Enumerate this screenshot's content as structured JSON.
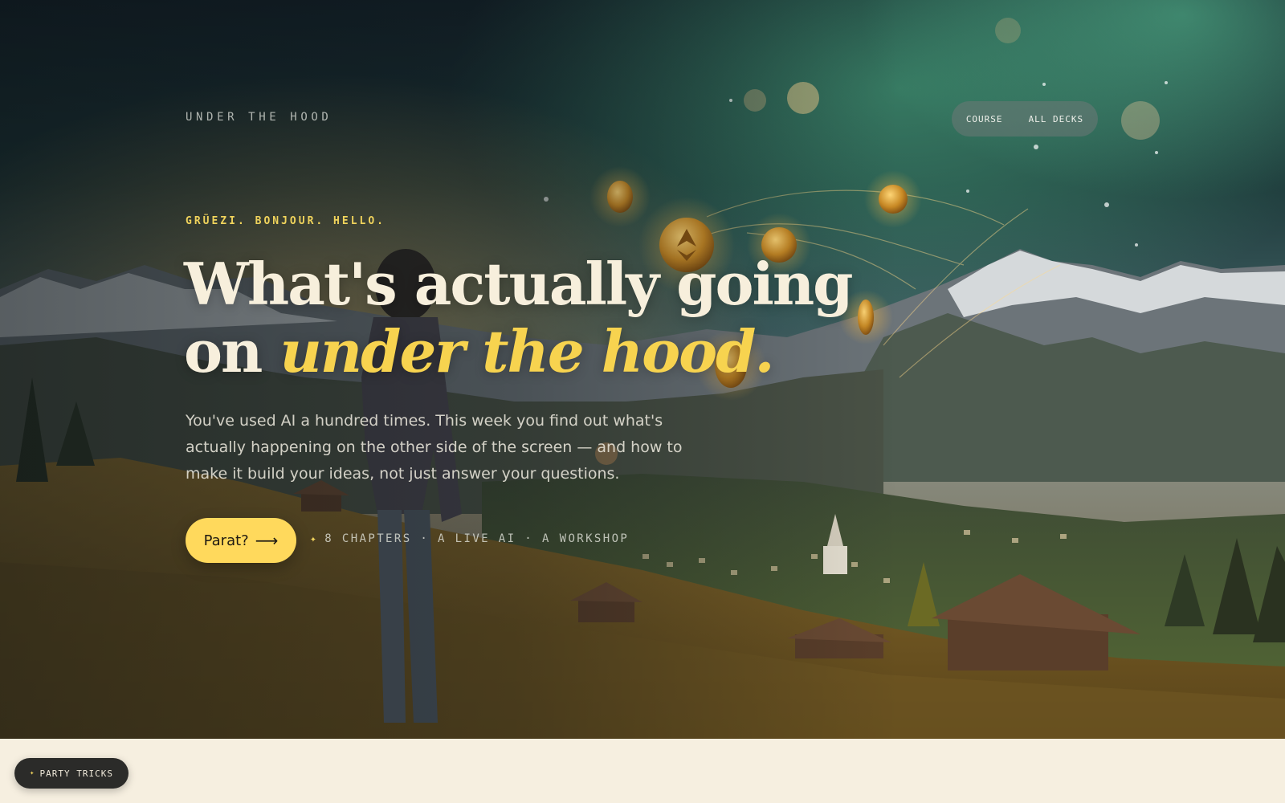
{
  "brand": {
    "label": "UNDER THE HOOD"
  },
  "nav": {
    "items": [
      {
        "label": "COURSE"
      },
      {
        "label": "ALL DECKS"
      }
    ]
  },
  "hero": {
    "eyebrow": "GRÜEZI. BONJOUR. HELLO.",
    "headline_line1": "What's actually going",
    "headline_line2_plain": "on ",
    "headline_line2_accent": "under the hood.",
    "lede": "You've used AI a hundred times. This week you find out what's actually happening on the other side of the screen — and how to make it build your ideas, not just answer your questions.",
    "cta_label": "Parat?",
    "cta_icon": "arrow-right-icon",
    "meta_icon": "sparkle-icon",
    "meta_text": "8 CHAPTERS · A LIVE AI · A WORKSHOP",
    "background_image": "alpine-valley-with-floating-coins"
  },
  "floating_button": {
    "icon": "sparkle-icon",
    "label": "PARTY TRICKS"
  },
  "colors": {
    "accent": "#f7d34f",
    "cta_bg": "#ffd95c",
    "headline": "#f7efdc",
    "page_bg": "#f6efe0",
    "pill_dark": "#2b2b29"
  }
}
